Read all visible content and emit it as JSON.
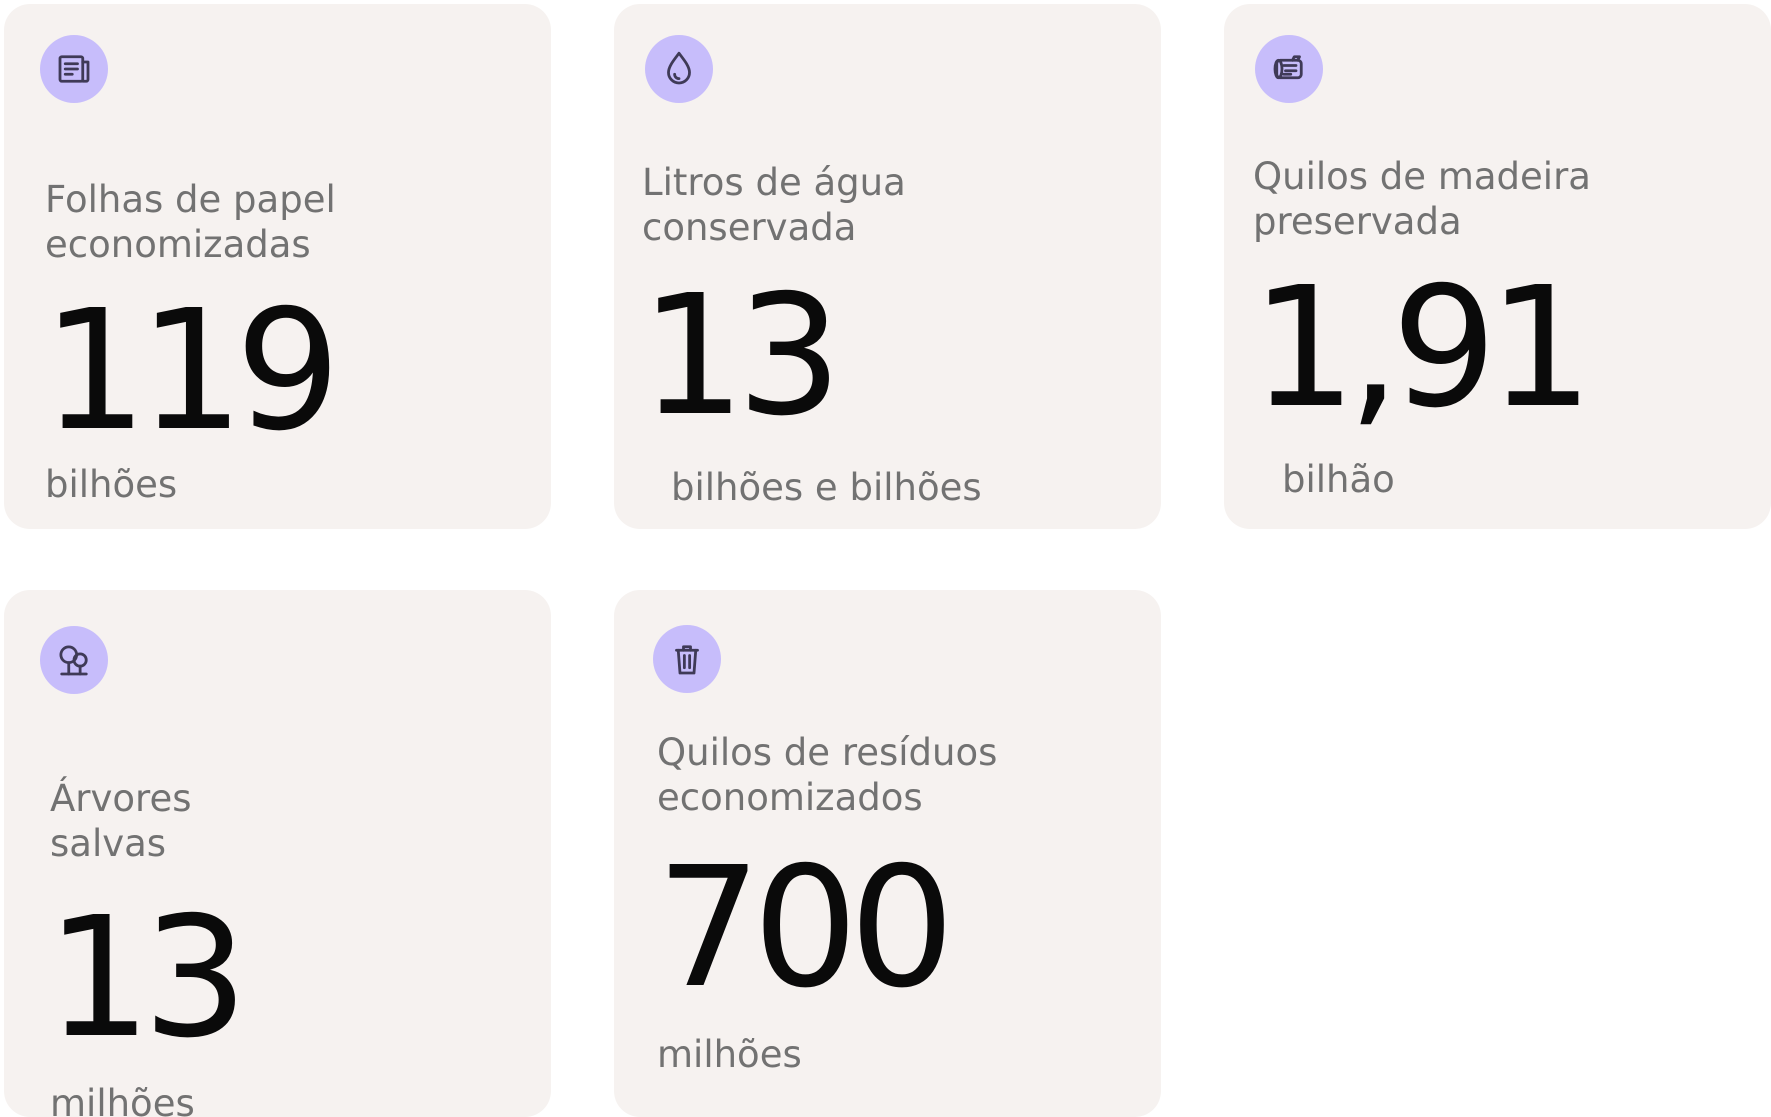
{
  "stats": [
    {
      "icon": "newspaper-icon",
      "label_line1": "Folhas de papel",
      "label_line2": "economizadas",
      "value": "119",
      "unit": "bilhões"
    },
    {
      "icon": "water-drop-icon",
      "label_line1": "Litros de água",
      "label_line2": "conservada",
      "value": "13",
      "unit": "bilhões e bilhões"
    },
    {
      "icon": "log-icon",
      "label_line1": "Quilos de madeira",
      "label_line2": "preservada",
      "value": "1,91",
      "unit": "bilhão"
    },
    {
      "icon": "trees-icon",
      "label_line1": "Árvores",
      "label_line2": "salvas",
      "value": "13",
      "unit": "milhões"
    },
    {
      "icon": "trash-can-icon",
      "label_line1": "Quilos de resíduos",
      "label_line2": "economizados",
      "value": "700",
      "unit": "milhões"
    }
  ],
  "colors": {
    "card_background": "#f6f2f0",
    "icon_circle": "#c7bdfb",
    "label_text": "#727272",
    "value_text": "#0a0a0a"
  }
}
